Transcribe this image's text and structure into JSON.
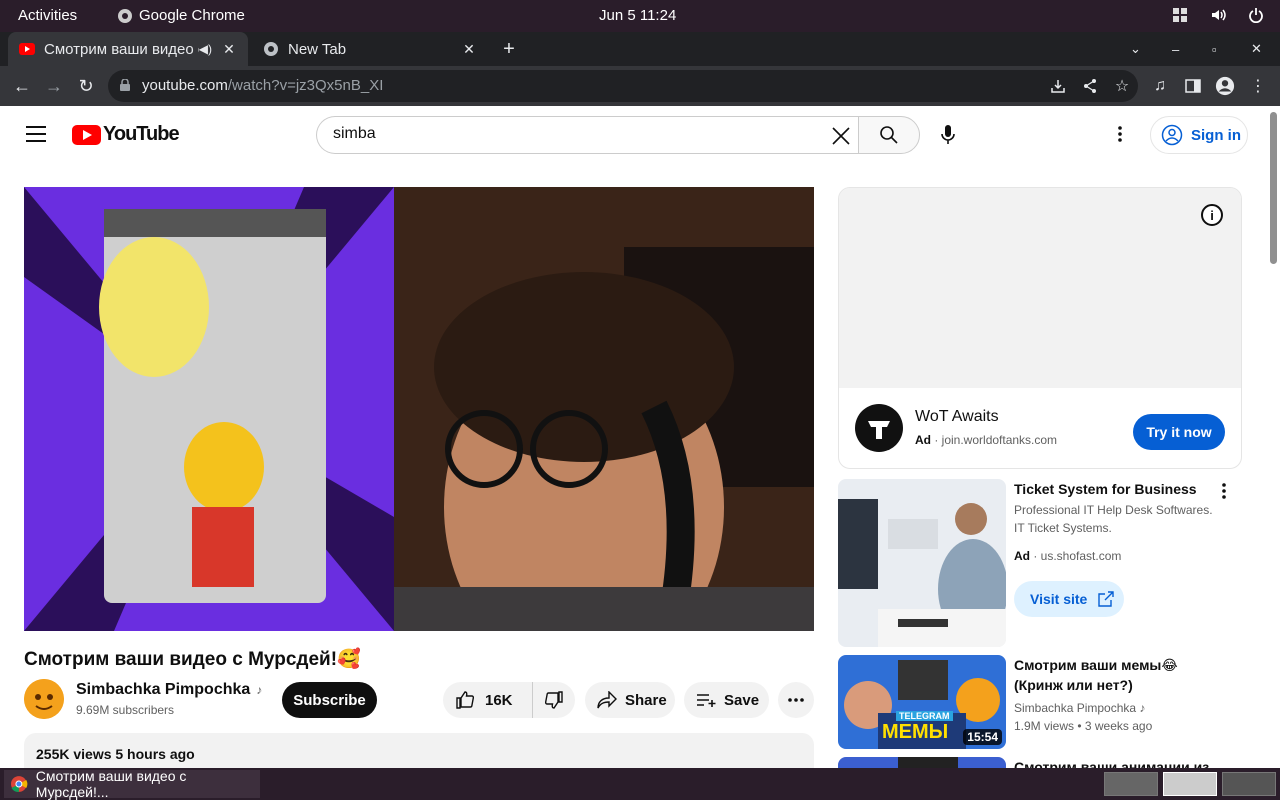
{
  "system": {
    "activities": "Activities",
    "app_name": "Google Chrome",
    "clock": "Jun 5  11:24"
  },
  "browser": {
    "tabs": [
      {
        "title": "Смотрим ваши видео с Мурсдей!",
        "active": true
      },
      {
        "title": "New Tab",
        "active": false
      }
    ],
    "url_host": "youtube.com",
    "url_path": "/watch?v=jz3Qx5nB_XI"
  },
  "youtube": {
    "logo_text": "YouTube",
    "search": {
      "value": "simba"
    },
    "sign_in": "Sign in",
    "video": {
      "title": "Смотрим ваши видео с Мурсдей!🥰",
      "channel": "Simbachka Pimpochka",
      "subscribers": "9.69M subscribers",
      "subscribe_label": "Subscribe",
      "likes": "16K",
      "share_label": "Share",
      "save_label": "Save",
      "description_meta": "255K views  5 hours ago"
    },
    "ad": {
      "title": "WoT Awaits",
      "label": "Ad",
      "domain": "join.worldoftanks.com",
      "cta": "Try it now"
    },
    "recommendations": [
      {
        "title": "Ticket System for Business",
        "line1": "Professional IT Help Desk Softwares.",
        "line2": "IT Ticket Systems.",
        "ad_label": "Ad",
        "ad_domain": "us.shofast.com",
        "cta": "Visit site"
      },
      {
        "title": "Смотрим ваши мемы😂 (Кринж или нет?)",
        "channel": "Simbachka Pimpochka",
        "meta": "1.9M views  •  3 weeks ago",
        "duration": "15:54",
        "thumb_text": "МЕМЫ",
        "thumb_tag": "TELEGRAM"
      },
      {
        "title": "Смотрим ваши анимации из"
      }
    ]
  },
  "taskbar": {
    "window_title": "Смотрим ваши видео с Мурсдей!..."
  }
}
